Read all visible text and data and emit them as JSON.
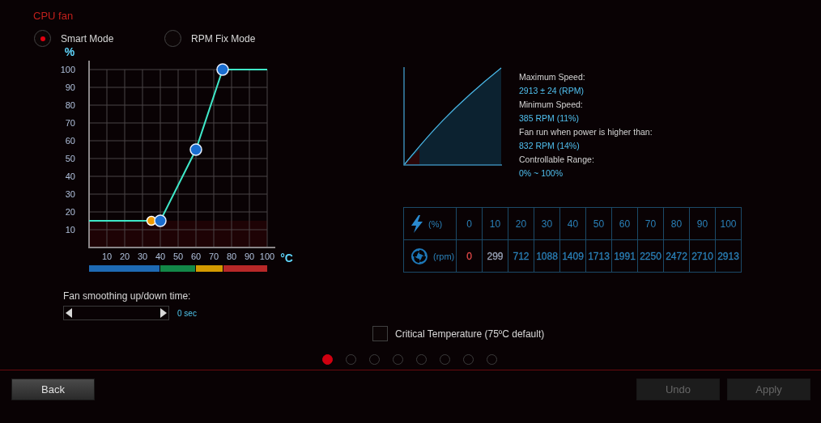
{
  "title": "CPU fan",
  "modes": [
    {
      "label": "Smart Mode",
      "selected": true
    },
    {
      "label": "RPM Fix Mode",
      "selected": false
    }
  ],
  "fan_curve": {
    "chart_data": {
      "type": "line",
      "ylabel": "%",
      "xlabel": "°C",
      "x": [
        0,
        35,
        40,
        60,
        75,
        100
      ],
      "series": [
        {
          "color": "#3fe8c8",
          "marker": true,
          "values": [
            15,
            null,
            15,
            55,
            100,
            100
          ]
        },
        {
          "color": "#f09a00",
          "marker": true,
          "values": [
            null,
            15,
            null,
            null,
            null,
            null
          ]
        }
      ],
      "xlim": [
        0,
        100
      ],
      "ylim": [
        0,
        100
      ],
      "grid": true,
      "xticks": [
        10,
        20,
        30,
        40,
        50,
        60,
        70,
        80,
        90,
        100
      ],
      "yticks": [
        10,
        20,
        30,
        40,
        50,
        60,
        70,
        80,
        90,
        100
      ]
    },
    "temp_zones": [
      {
        "color": "#1e6ab4"
      },
      {
        "color": "#138848"
      },
      {
        "color": "#d49a00"
      },
      {
        "color": "#b82828"
      }
    ]
  },
  "speed_info": [
    {
      "label": "Maximum Speed:",
      "value": "2913 ± 24 (RPM)"
    },
    {
      "label": "Minimum Speed:",
      "value": "385 RPM (11%)"
    },
    {
      "label": "Fan run when power is higher than:",
      "value": "832 RPM (14%)"
    },
    {
      "label": "Controllable Range:",
      "value": "0% ~ 100%"
    }
  ],
  "speed_table": {
    "power_unit": "(%)",
    "rpm_unit": "(rpm)",
    "power": [
      "0",
      "10",
      "20",
      "30",
      "40",
      "50",
      "60",
      "70",
      "80",
      "90",
      "100"
    ],
    "rpm": [
      {
        "text": "0",
        "color": "#e04848"
      },
      {
        "text": "299",
        "color": "#9aa4b8"
      },
      {
        "text": "712",
        "color": "#2a80b8"
      },
      {
        "text": "1088",
        "color": "#2a80b8"
      },
      {
        "text": "1409",
        "color": "#2a80b8"
      },
      {
        "text": "1713",
        "color": "#2a80b8"
      },
      {
        "text": "1991",
        "color": "#2a80b8"
      },
      {
        "text": "2250",
        "color": "#2a80b8"
      },
      {
        "text": "2472",
        "color": "#2a80b8"
      },
      {
        "text": "2710",
        "color": "#2a80b8"
      },
      {
        "text": "2913",
        "color": "#2a80b8"
      }
    ]
  },
  "smoothing": {
    "label": "Fan smoothing up/down time:",
    "value": "0 sec",
    "level": 0
  },
  "critical": {
    "label": "Critical Temperature (75ºC default)",
    "checked": false
  },
  "pages": [
    {
      "selected": true
    },
    {
      "selected": false
    },
    {
      "selected": false
    },
    {
      "selected": false
    },
    {
      "selected": false
    },
    {
      "selected": false
    },
    {
      "selected": false
    },
    {
      "selected": false
    }
  ],
  "buttons": [
    {
      "label": "Back",
      "disabled": false
    },
    {
      "label": "Undo",
      "disabled": true
    },
    {
      "label": "Apply",
      "disabled": true
    }
  ]
}
